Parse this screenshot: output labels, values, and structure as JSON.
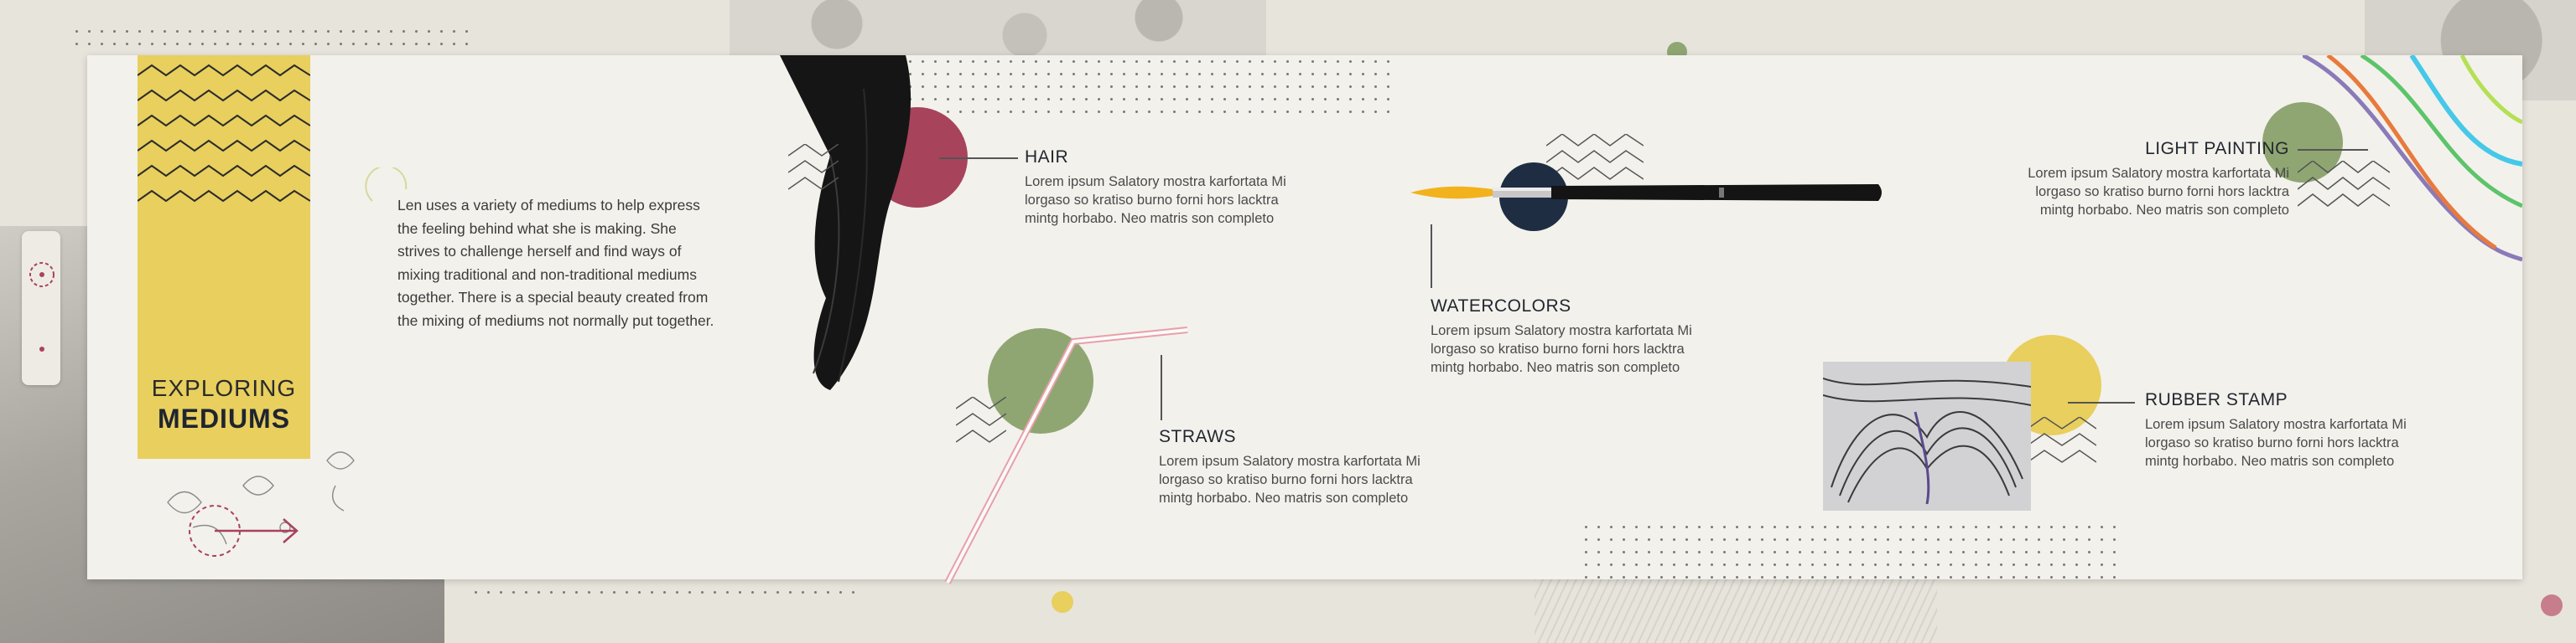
{
  "title": {
    "line1": "EXPLORING",
    "line2": "MEDIUMS"
  },
  "intro": "Len uses a variety of mediums to help express the feeling behind what she is making. She strives to challenge herself and find ways of mixing traditional and non-traditional mediums together. There is a special beauty created from the mixing of mediums not normally put together.",
  "mediums": [
    {
      "id": "hair",
      "heading": "HAIR",
      "body": "Lorem ipsum Salatory mostra karfortata Mi lorgaso so kratiso burno forni hors lacktra mintg horbabo. Neo matris son completo"
    },
    {
      "id": "straws",
      "heading": "STRAWS",
      "body": "Lorem ipsum Salatory mostra karfortata Mi lorgaso so kratiso burno forni hors lacktra mintg horbabo. Neo matris son completo"
    },
    {
      "id": "watercolors",
      "heading": "WATERCOLORS",
      "body": "Lorem ipsum Salatory mostra karfortata Mi lorgaso so kratiso burno forni hors lacktra mintg horbabo. Neo matris son completo"
    },
    {
      "id": "light-painting",
      "heading": "LIGHT PAINTING",
      "body": "Lorem ipsum Salatory mostra karfortata Mi lorgaso so kratiso burno forni hors lacktra mintg horbabo. Neo matris son completo"
    },
    {
      "id": "rubber-stamp",
      "heading": "RUBBER STAMP",
      "body": "Lorem ipsum Salatory mostra karfortata Mi lorgaso so kratiso burno forni hors lacktra mintg horbabo. Neo matris son completo"
    }
  ],
  "colors": {
    "accent_yellow": "#e8cf5e",
    "accent_red": "#a8435c",
    "accent_green": "#8fa672",
    "accent_navy": "#1e2d42",
    "card": "#f3f1ec"
  },
  "icons": [
    "dashed-circle-icon",
    "arrow-right-icon",
    "zigzag-icon",
    "floral-sketch-icon"
  ]
}
